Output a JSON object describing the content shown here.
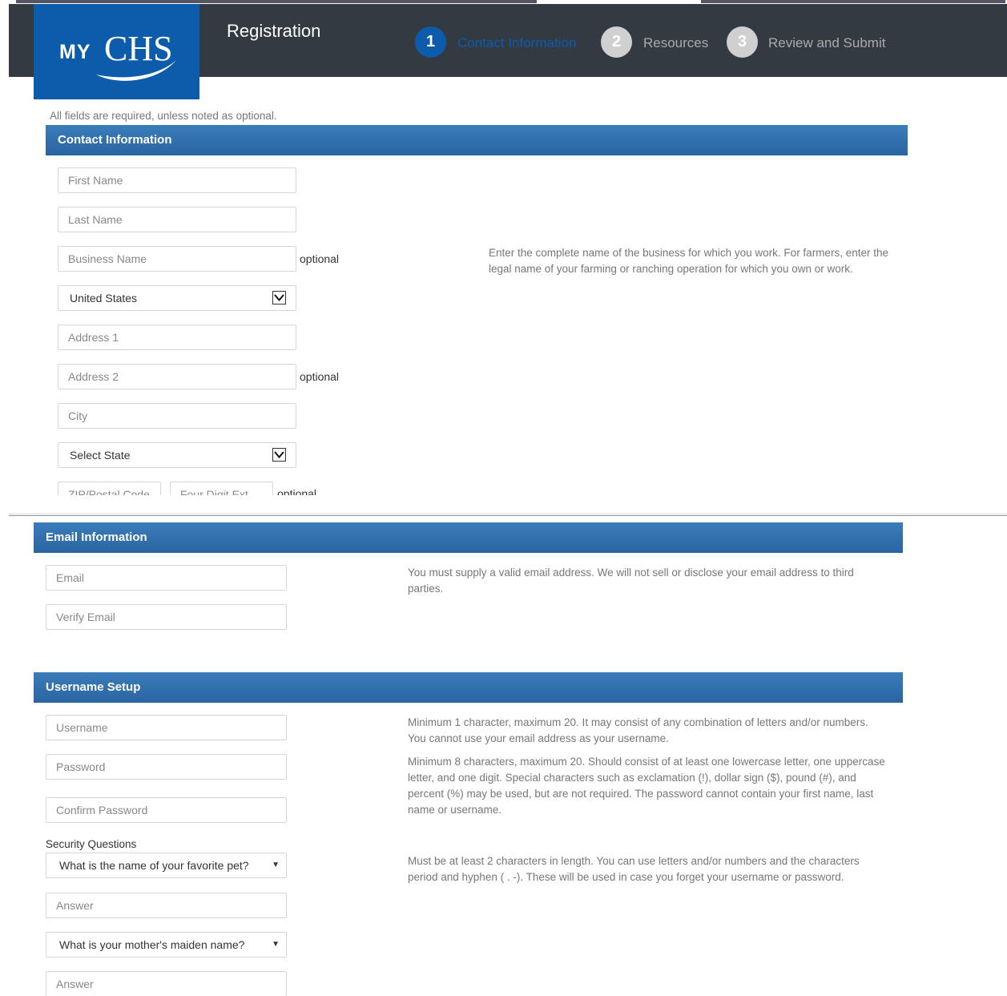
{
  "header": {
    "logo_my": "MY",
    "logo_chs": "CHS",
    "title": "Registration",
    "steps": [
      {
        "num": "1",
        "label": "Contact Information",
        "active": true
      },
      {
        "num": "2",
        "label": "Resources",
        "active": false
      },
      {
        "num": "3",
        "label": "Review and Submit",
        "active": false
      }
    ]
  },
  "notice": "All fields are required, unless noted as optional.",
  "contact": {
    "heading": "Contact Information",
    "first_name_placeholder": "First Name",
    "last_name_placeholder": "Last Name",
    "business_name_placeholder": "Business Name",
    "optional_label": "optional",
    "business_help": "Enter the complete name of the business for which you work. For farmers, enter the legal name of your farming or ranching operation for which you own or work.",
    "country_value": "United States",
    "address1_placeholder": "Address 1",
    "address2_placeholder": "Address 2",
    "city_placeholder": "City",
    "state_value": "Select State",
    "zip_placeholder": "ZIP/Postal Code",
    "ext_placeholder": "Four Digit Ext"
  },
  "email": {
    "heading": "Email Information",
    "email_placeholder": "Email",
    "verify_placeholder": "Verify Email",
    "help": "You must supply a valid email address. We will not sell or disclose your email address to third parties."
  },
  "username": {
    "heading": "Username Setup",
    "username_placeholder": "Username",
    "password_placeholder": "Password",
    "confirm_placeholder": "Confirm Password",
    "username_help": "Minimum 1 character, maximum 20. It may consist of any combination of letters and/or numbers. You cannot use your email address as your username.",
    "password_help": "Minimum 8 characters, maximum 20. Should consist of at least one lowercase letter, one uppercase letter, and one digit. Special characters such as exclamation (!), dollar sign ($), pound (#), and percent (%) may be used, but are not required. The password cannot contain your first name, last name or username.",
    "security_label": "Security Questions",
    "question1": "What is the name of your favorite pet?",
    "answer_placeholder": "Answer",
    "question2": "What is your mother's maiden name?",
    "security_help": "Must be at least 2 characters in length. You can use letters and/or numbers and the characters period and hyphen ( . -). These will be used in case you forget your username or password."
  },
  "colors": {
    "header_bg": "#343a42",
    "brand_blue": "#0d5bab",
    "panel_blue": "#2f6fa8",
    "active_step": "#0d5bab",
    "inactive_step": "#d0d0d0"
  }
}
